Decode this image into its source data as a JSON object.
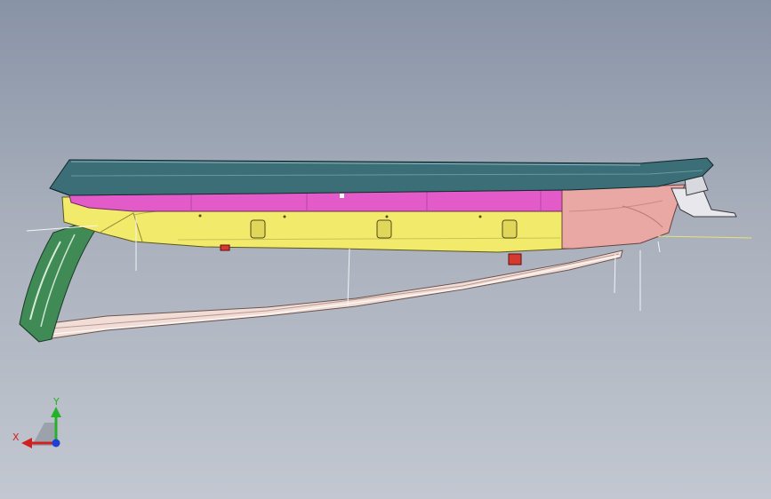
{
  "viewport": {
    "background_top": "#8893a6",
    "background_bottom": "#c2c7d0"
  },
  "model": {
    "parts": [
      {
        "name": "roof-panel",
        "color": "#3c6e78"
      },
      {
        "name": "inner-trim",
        "color": "#e35bc8"
      },
      {
        "name": "side-rail",
        "color": "#f2ea6a"
      },
      {
        "name": "rear-cap",
        "color": "#eaa8a4"
      },
      {
        "name": "front-bracket",
        "color": "#3f8a55"
      },
      {
        "name": "lower-arm",
        "color": "#f2ddd6"
      },
      {
        "name": "mount-clip",
        "color": "#d63a2e"
      }
    ]
  },
  "triad": {
    "x_label": "X",
    "y_label": "Y",
    "x_color": "#d12020",
    "y_color": "#25b12a",
    "z_color": "#1e3fd6"
  }
}
